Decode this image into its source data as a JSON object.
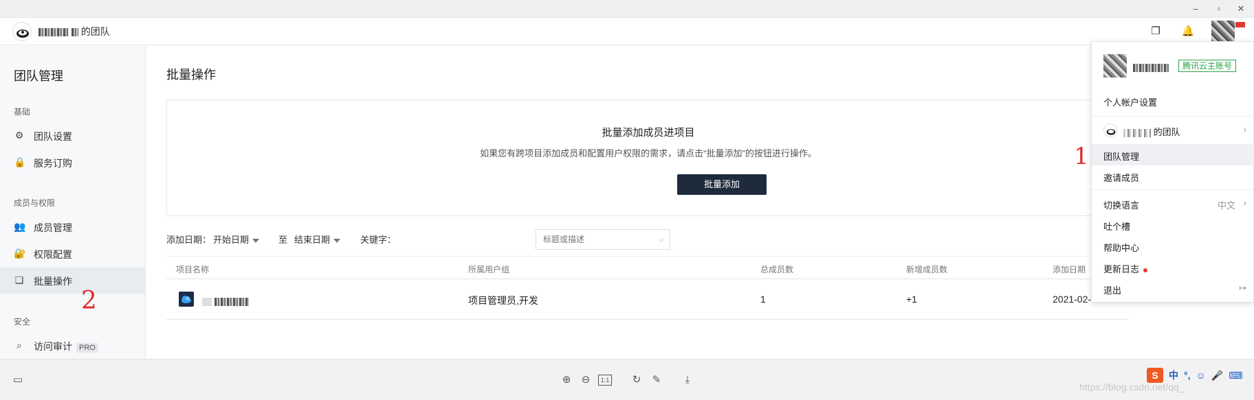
{
  "header": {
    "team_name": "的团队"
  },
  "sidebar": {
    "title": "团队管理",
    "groups": [
      {
        "label": "基础",
        "items": [
          {
            "label": "团队设置"
          },
          {
            "label": "服务订购"
          }
        ]
      },
      {
        "label": "成员与权限",
        "items": [
          {
            "label": "成员管理"
          },
          {
            "label": "权限配置"
          },
          {
            "label": "批量操作"
          }
        ]
      },
      {
        "label": "安全",
        "items": [
          {
            "label": "访问审计",
            "badge": "PRO"
          }
        ]
      }
    ]
  },
  "main": {
    "page_title": "批量操作",
    "card": {
      "title": "批量添加成员进项目",
      "description": "如果您有跨项目添加成员和配置用户权限的需求，请点击“批量添加”的按钮进行操作。",
      "button": "批量添加"
    },
    "filters": {
      "date_label": "添加日期：",
      "start_date": "开始日期",
      "to": "至",
      "end_date": "结束日期",
      "keyword_label": "关键字：",
      "keyword_placeholder": "标题或描述"
    },
    "table": {
      "columns": [
        "项目名称",
        "所属用户组",
        "总成员数",
        "新增成员数",
        "添加日期"
      ],
      "rows": [
        {
          "group": "项目管理员,开发",
          "total": "1",
          "added": "+1",
          "date": "2021-02-"
        }
      ]
    }
  },
  "dropdown": {
    "account_badge": "腾讯云主账号",
    "items": [
      {
        "label": "个人帐户设置"
      },
      {
        "label": "的团队"
      },
      {
        "label": "团队管理"
      },
      {
        "label": "邀请成员"
      },
      {
        "label": "切换语言",
        "value": "中文"
      },
      {
        "label": "吐个槽"
      },
      {
        "label": "帮助中心"
      },
      {
        "label": "更新日志"
      },
      {
        "label": "退出"
      }
    ]
  },
  "annotations": {
    "one": "1",
    "two": "2"
  },
  "bottombar": {
    "zoom_reset": "1:1",
    "watermark": "https://blog.csdn.net/qq_",
    "ime_label": "中"
  },
  "colors": {
    "primary_button": "#1e2b3d",
    "account_badge": "#2ba245",
    "annotation": "#e02b2b",
    "ime_brand": "#f05a22"
  }
}
